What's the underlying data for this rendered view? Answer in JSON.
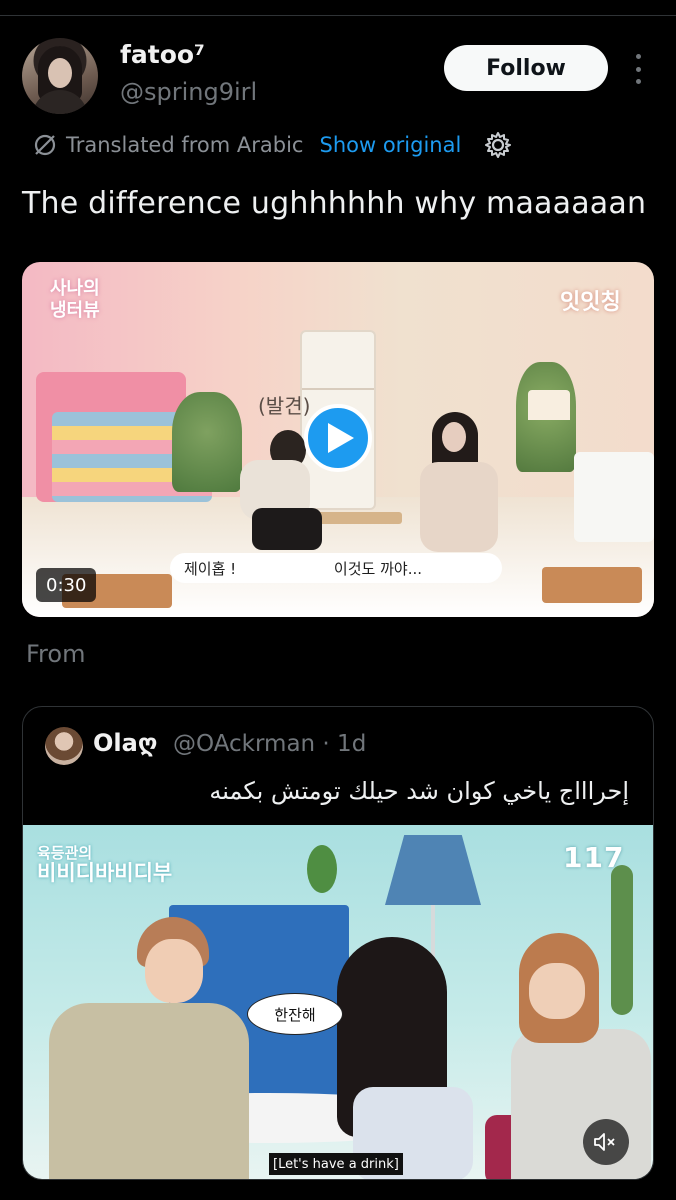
{
  "tweet": {
    "display_name": "fatoo⁷",
    "handle": "@spring9irl",
    "follow_label": "Follow",
    "translated_label": "Translated from Arabic",
    "show_original_label": "Show original",
    "text": "The difference ughhhhhh why maaaaaan",
    "from_label": "From"
  },
  "video1": {
    "logo_left": "사나의\n냉터뷰",
    "logo_right": "잇잇칭",
    "bubble_text": "(발견)",
    "caption_left": "제이홉 !",
    "caption_right": "이것도 까야...",
    "duration": "0:30"
  },
  "quote": {
    "name": "Olaღ",
    "handle_time": "@OAckrman · 1d",
    "text": "إحراااج ياخي كوان شد حيلك تومتش بكمنه"
  },
  "video2": {
    "logo_left_top": "육등관의",
    "logo_left_bottom": "비비디바비디부",
    "logo_right": "117",
    "speech_bubble": "한잔해",
    "subtitle": "[Let's have a drink]"
  },
  "colors": {
    "background": "#000000",
    "accent": "#1d9bf0",
    "secondary_text": "#71767b",
    "primary_text": "#e7e9ea"
  }
}
